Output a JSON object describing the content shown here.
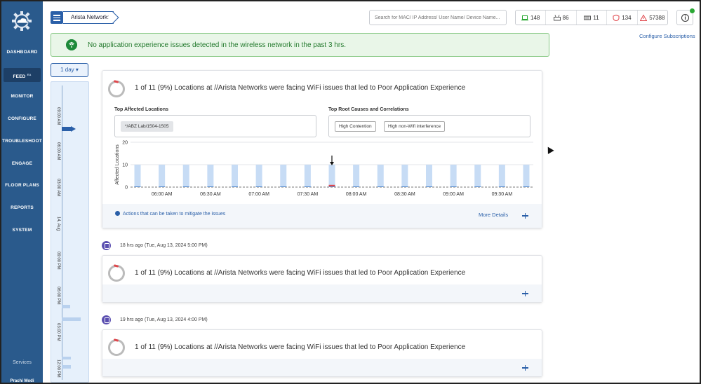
{
  "sidebar": {
    "items": [
      {
        "label": "DASHBOARD"
      },
      {
        "label": "FEED",
        "badge": "EA"
      },
      {
        "label": "MONITOR"
      },
      {
        "label": "CONFIGURE"
      },
      {
        "label": "TROUBLESHOOT"
      },
      {
        "label": "ENGAGE"
      },
      {
        "label": "FLOOR PLANS"
      },
      {
        "label": "REPORTS"
      },
      {
        "label": "SYSTEM"
      }
    ],
    "services": "Services",
    "user": "Prachi Modi"
  },
  "header": {
    "breadcrumb": "Arista Networks",
    "search_placeholder": "Search for MAC/ IP Address/ User Name/ Device Name...",
    "stats": [
      {
        "icon": "laptop-icon",
        "value": "148"
      },
      {
        "icon": "switch-icon",
        "value": "86"
      },
      {
        "icon": "server-icon",
        "value": "11"
      },
      {
        "icon": "shield-icon",
        "value": "134"
      },
      {
        "icon": "warning-icon",
        "value": "57388"
      }
    ]
  },
  "banner": {
    "text": "No application experience issues detected in the wireless network in the past 3 hrs."
  },
  "configure_subscriptions": "Configure Subscriptions",
  "timeline": {
    "range": "1 day",
    "labels": [
      "09:00 AM",
      "06:00 AM",
      "03:00 AM",
      "14, Aug",
      "09:00 PM",
      "06:00 PM",
      "03:00 PM",
      "12:00 PM"
    ]
  },
  "cards": [
    {
      "title": "1 of 11 (9%) Locations at //Arista Networks were facing WiFi issues that led to Poor Application Experience",
      "top_locations_label": "Top Affected Locations",
      "locations": [
        "*/ABZ Lab/1504-1505"
      ],
      "top_causes_label": "Top Root Causes and Correlations",
      "causes": [
        "High Contention",
        "High non-Wifi interference"
      ],
      "actions": "Actions that can be taken to mitigate the issues",
      "more_details": "More Details"
    },
    {
      "time": "18 hrs ago (Tue, Aug 13, 2024 5:00 PM)",
      "title": "1 of 11 (9%) Locations at //Arista Networks were facing WiFi issues that led to Poor Application Experience"
    },
    {
      "time": "19 hrs ago (Tue, Aug 13, 2024 4:00 PM)",
      "title": "1 of 11 (9%) Locations at //Arista Networks were facing WiFi issues that led to Poor Application Experience"
    }
  ],
  "chart_data": {
    "type": "bar",
    "ylabel": "Affected Locations",
    "ylim": [
      0,
      20
    ],
    "yticks": [
      0,
      10,
      20
    ],
    "tick_labels": [
      "06:00 AM",
      "06:30 AM",
      "07:00 AM",
      "07:30 AM",
      "08:00 AM",
      "08:30 AM",
      "09:00 AM",
      "09:30 AM"
    ],
    "series": [
      {
        "color": "#c7dcf5",
        "values": [
          10,
          10,
          10,
          10,
          10,
          10,
          10,
          10,
          10,
          10,
          10,
          10,
          10,
          10,
          10,
          10,
          10
        ]
      },
      {
        "color": "#e0484d",
        "values": [
          0,
          0,
          0,
          0,
          0,
          0,
          0,
          0,
          1,
          0,
          0,
          0,
          0,
          0,
          0,
          0,
          0
        ]
      }
    ],
    "highlight_index": 8
  }
}
